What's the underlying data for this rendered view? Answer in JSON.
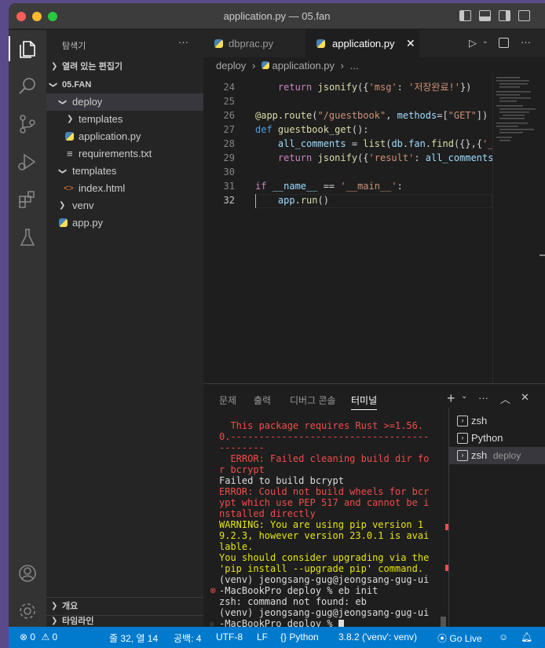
{
  "window": {
    "title": "application.py — 05.fan"
  },
  "sidebar": {
    "header": "탐색기",
    "more": "···",
    "open_editors": "열려 있는 편집기",
    "root": "05.FAN",
    "items": [
      {
        "label": "deploy",
        "kind": "folder-open"
      },
      {
        "label": "templates",
        "kind": "folder"
      },
      {
        "label": "application.py",
        "kind": "python"
      },
      {
        "label": "requirements.txt",
        "kind": "text"
      },
      {
        "label": "templates",
        "kind": "folder-open"
      },
      {
        "label": "index.html",
        "kind": "html"
      },
      {
        "label": "venv",
        "kind": "folder"
      },
      {
        "label": "app.py",
        "kind": "python"
      }
    ],
    "outline": "개요",
    "timeline": "타임라인"
  },
  "editor": {
    "tabs": [
      {
        "label": "dbprac.py",
        "active": false
      },
      {
        "label": "application.py",
        "active": true
      }
    ],
    "breadcrumb": {
      "folder": "deploy",
      "file": "application.py",
      "more": "..."
    },
    "lines": [
      {
        "n": "24",
        "code": [
          {
            "t": "    "
          },
          {
            "t": "return",
            "c": "pu"
          },
          {
            "t": " "
          },
          {
            "t": "jsonify",
            "c": "fn"
          },
          {
            "t": "({"
          },
          {
            "t": "'msg'",
            "c": "st"
          },
          {
            "t": ": "
          },
          {
            "t": "'저장완료!'",
            "c": "st"
          },
          {
            "t": "})"
          }
        ]
      },
      {
        "n": "25",
        "code": []
      },
      {
        "n": "26",
        "code": [
          {
            "t": "@app.route",
            "c": "fn"
          },
          {
            "t": "("
          },
          {
            "t": "\"/guestbook\"",
            "c": "st"
          },
          {
            "t": ", "
          },
          {
            "t": "methods",
            "c": "pa"
          },
          {
            "t": "=["
          },
          {
            "t": "\"GET\"",
            "c": "st"
          },
          {
            "t": "])"
          }
        ]
      },
      {
        "n": "27",
        "code": [
          {
            "t": "def",
            "c": "kw"
          },
          {
            "t": " "
          },
          {
            "t": "guestbook_get",
            "c": "fn"
          },
          {
            "t": "():"
          }
        ]
      },
      {
        "n": "28",
        "code": [
          {
            "t": "    "
          },
          {
            "t": "all_comments",
            "c": "pa"
          },
          {
            "t": " = "
          },
          {
            "t": "list",
            "c": "fn"
          },
          {
            "t": "("
          },
          {
            "t": "db",
            "c": "pa"
          },
          {
            "t": "."
          },
          {
            "t": "fan",
            "c": "pa"
          },
          {
            "t": "."
          },
          {
            "t": "find",
            "c": "fn"
          },
          {
            "t": "({},{"
          },
          {
            "t": "'_",
            "c": "st"
          }
        ]
      },
      {
        "n": "29",
        "code": [
          {
            "t": "    "
          },
          {
            "t": "return",
            "c": "pu"
          },
          {
            "t": " "
          },
          {
            "t": "jsonify",
            "c": "fn"
          },
          {
            "t": "({"
          },
          {
            "t": "'result'",
            "c": "st"
          },
          {
            "t": ": "
          },
          {
            "t": "all_comments",
            "c": "pa"
          }
        ]
      },
      {
        "n": "30",
        "code": []
      },
      {
        "n": "31",
        "code": [
          {
            "t": "if",
            "c": "pu"
          },
          {
            "t": " "
          },
          {
            "t": "__name__",
            "c": "pa"
          },
          {
            "t": " == "
          },
          {
            "t": "'__main__'",
            "c": "st"
          },
          {
            "t": ":"
          }
        ]
      },
      {
        "n": "32",
        "code": [
          {
            "t": "    "
          },
          {
            "t": "app",
            "c": "pa"
          },
          {
            "t": "."
          },
          {
            "t": "run",
            "c": "fn"
          },
          {
            "t": "()"
          }
        ]
      }
    ]
  },
  "panel": {
    "tabs": [
      "문제",
      "출력",
      "디버그 콘솔",
      "터미널"
    ],
    "active_tab": "터미널",
    "terminal_lines": [
      {
        "text": "  This package requires Rust >=1.56.0.",
        "c": "err"
      },
      {
        "text": "  -------------------------------------------",
        "c": "err"
      },
      {
        "text": "  ERROR: Failed cleaning build dir for bcrypt",
        "c": "err"
      },
      {
        "text": "Failed to build bcrypt",
        "c": "norm"
      },
      {
        "text": "ERROR: Could not build wheels for bcrypt which use PEP 517 and cannot be installed directly",
        "c": "err"
      },
      {
        "text": "WARNING: You are using pip version 19.2.3, however version 23.0.1 is available.",
        "c": "warn"
      },
      {
        "text": "You should consider upgrading via the 'pip install --upgrade pip' command.",
        "c": "warn"
      },
      {
        "text": "(venv) jeongsang-gug@jeongsang-gug-ui-MacBookPro deploy % eb init",
        "c": "norm"
      },
      {
        "text": "zsh: command not found: eb",
        "c": "norm"
      },
      {
        "text": "(venv) jeongsang-gug@jeongsang-gug-ui-MacBookPro deploy % ",
        "c": "norm"
      }
    ],
    "terminals": [
      {
        "name": "zsh",
        "sub": ""
      },
      {
        "name": "Python",
        "sub": ""
      },
      {
        "name": "zsh",
        "sub": "deploy"
      }
    ]
  },
  "status": {
    "errors": "0",
    "warnings": "0",
    "position": "줄 32, 열 14",
    "spaces": "공백: 4",
    "encoding": "UTF-8",
    "eol": "LF",
    "language": "Python",
    "interpreter": "3.8.2 ('venv': venv)",
    "golive": "Go Live"
  },
  "colors": {
    "accent": "#007acc",
    "error": "#f14c4c",
    "warning": "#e5e510"
  }
}
